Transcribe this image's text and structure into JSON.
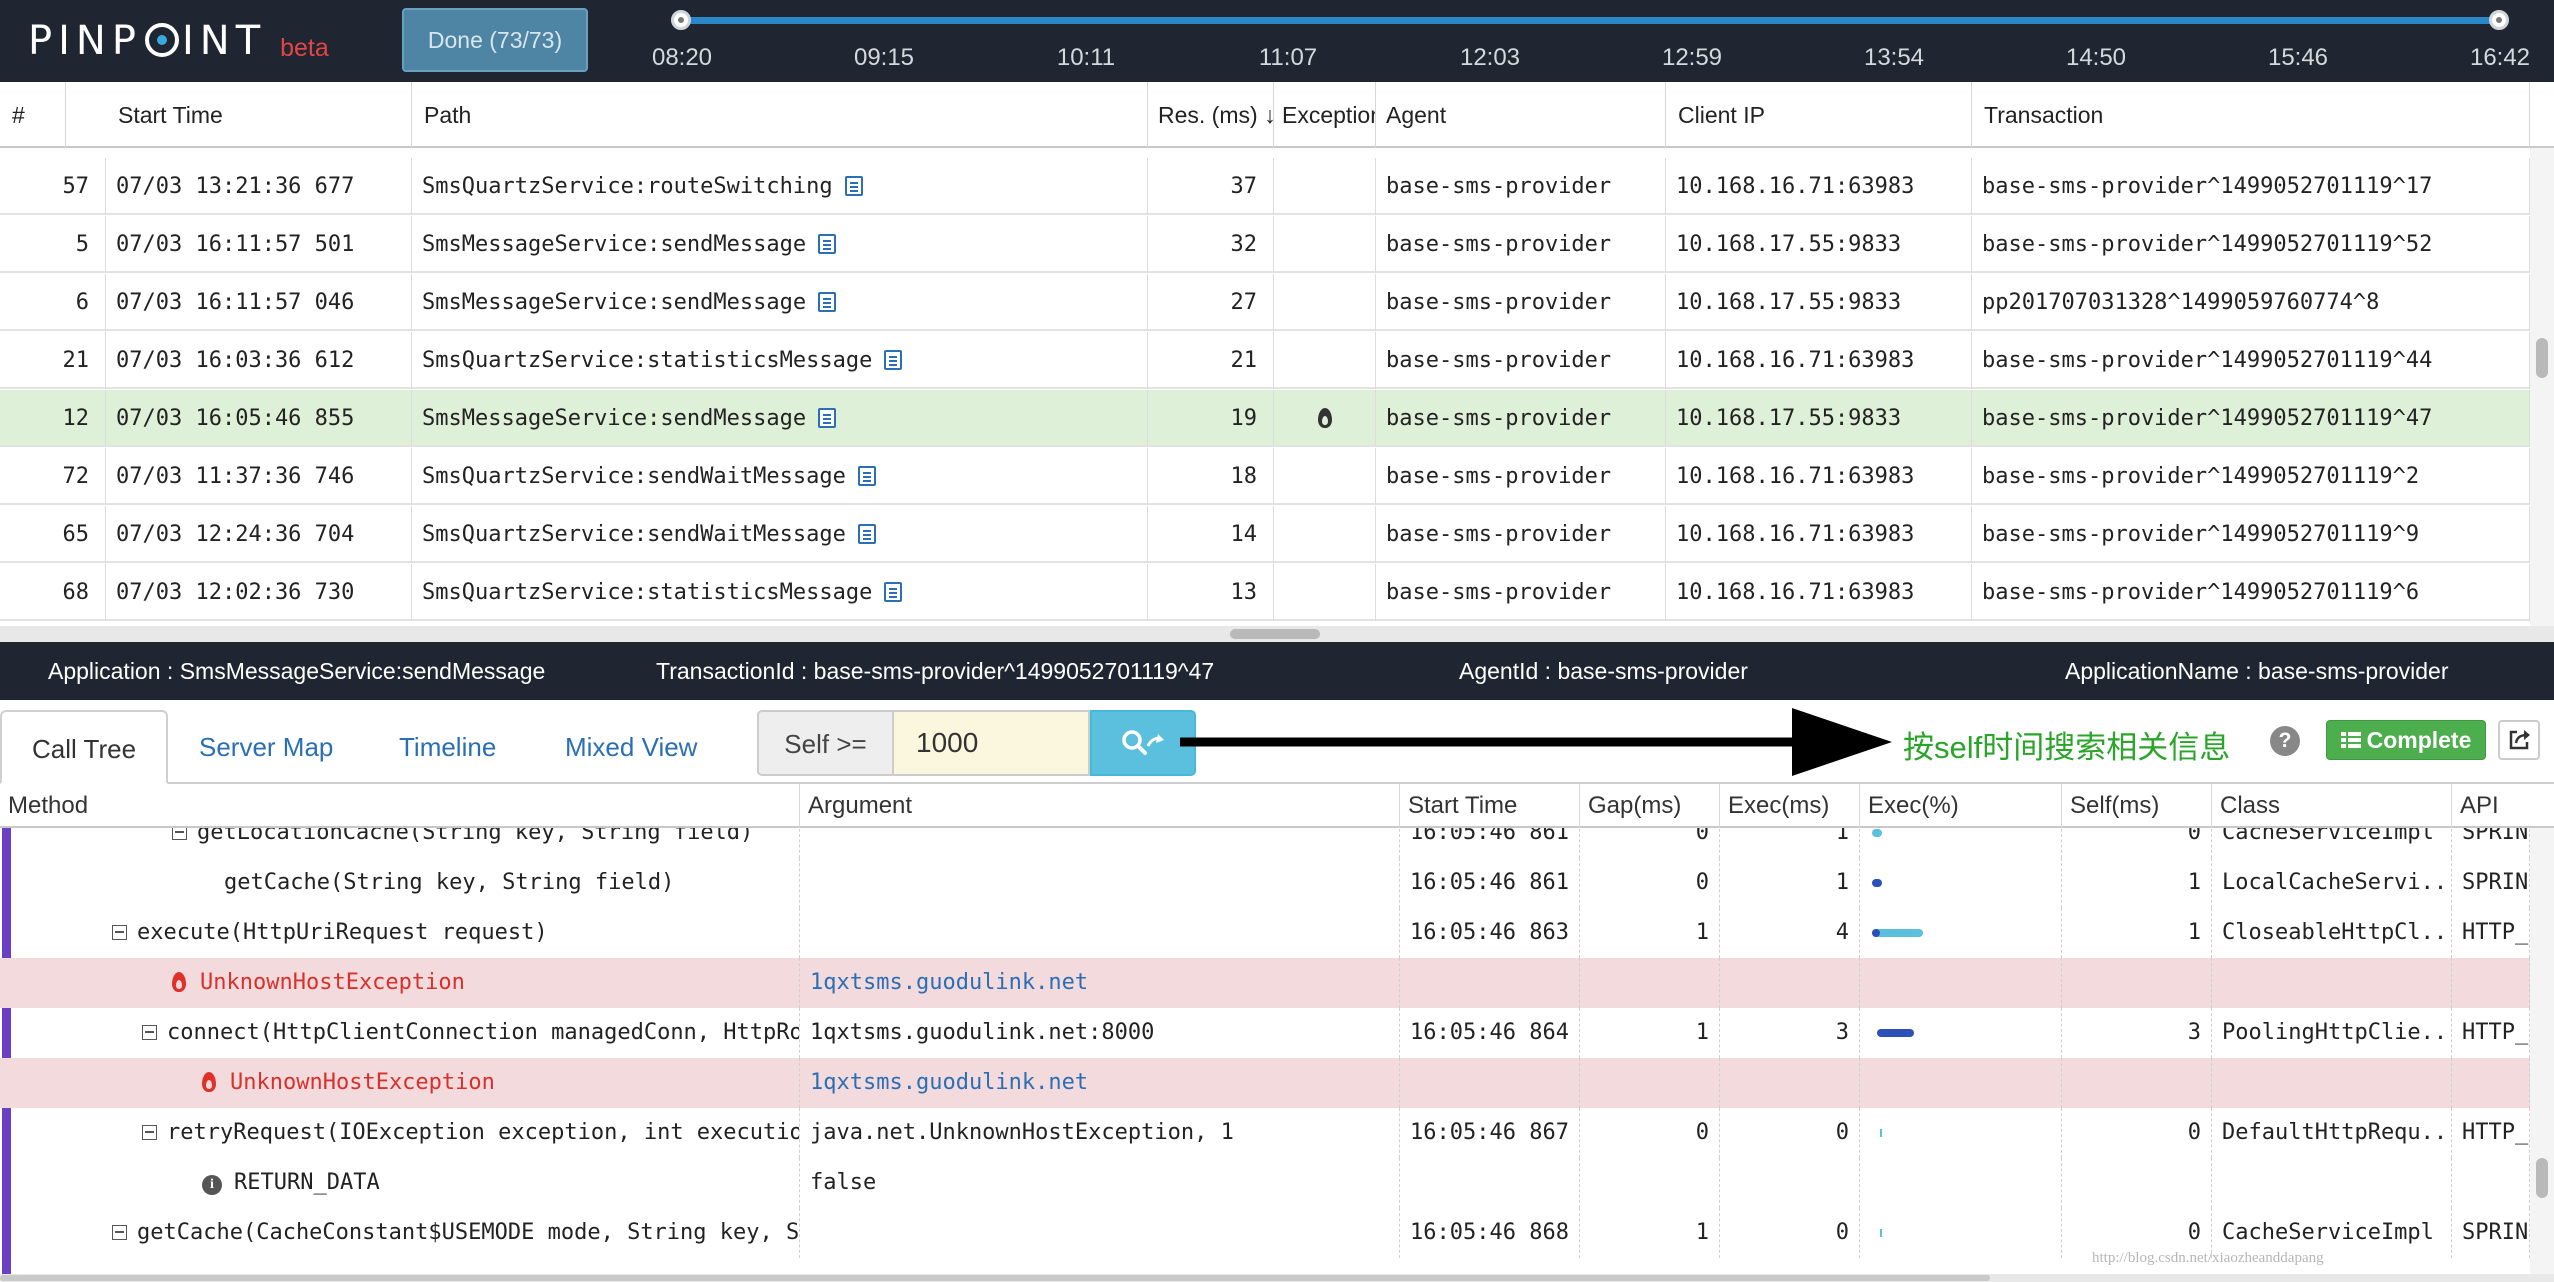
{
  "header": {
    "logo_text": "PINPOINT",
    "beta": "beta",
    "done_button": "Done (73/73)",
    "timeline_ticks": [
      "08:20",
      "09:15",
      "10:11",
      "11:07",
      "12:03",
      "12:59",
      "13:54",
      "14:50",
      "15:46",
      "16:42"
    ]
  },
  "transactions": {
    "columns": [
      "#",
      "Start Time",
      "Path",
      "Res. (ms)",
      "Exception",
      "Agent",
      "Client IP",
      "Transaction"
    ],
    "sort_indicator": "↓",
    "rows": [
      {
        "num": "57",
        "start": "07/03 13:21:36 677",
        "path": "SmsQuartzService:routeSwitching",
        "res": "37",
        "exception": false,
        "agent": "base-sms-provider",
        "ip": "10.168.16.71:63983",
        "tx": "base-sms-provider^1499052701119^17",
        "selected": false
      },
      {
        "num": "5",
        "start": "07/03 16:11:57 501",
        "path": "SmsMessageService:sendMessage",
        "res": "32",
        "exception": false,
        "agent": "base-sms-provider",
        "ip": "10.168.17.55:9833",
        "tx": "base-sms-provider^1499052701119^52",
        "selected": false
      },
      {
        "num": "6",
        "start": "07/03 16:11:57 046",
        "path": "SmsMessageService:sendMessage",
        "res": "27",
        "exception": false,
        "agent": "base-sms-provider",
        "ip": "10.168.17.55:9833",
        "tx": "pp201707031328^1499059760774^8",
        "selected": false
      },
      {
        "num": "21",
        "start": "07/03 16:03:36 612",
        "path": "SmsQuartzService:statisticsMessage",
        "res": "21",
        "exception": false,
        "agent": "base-sms-provider",
        "ip": "10.168.16.71:63983",
        "tx": "base-sms-provider^1499052701119^44",
        "selected": false
      },
      {
        "num": "12",
        "start": "07/03 16:05:46 855",
        "path": "SmsMessageService:sendMessage",
        "res": "19",
        "exception": true,
        "agent": "base-sms-provider",
        "ip": "10.168.17.55:9833",
        "tx": "base-sms-provider^1499052701119^47",
        "selected": true
      },
      {
        "num": "72",
        "start": "07/03 11:37:36 746",
        "path": "SmsQuartzService:sendWaitMessage",
        "res": "18",
        "exception": false,
        "agent": "base-sms-provider",
        "ip": "10.168.16.71:63983",
        "tx": "base-sms-provider^1499052701119^2",
        "selected": false
      },
      {
        "num": "65",
        "start": "07/03 12:24:36 704",
        "path": "SmsQuartzService:sendWaitMessage",
        "res": "14",
        "exception": false,
        "agent": "base-sms-provider",
        "ip": "10.168.16.71:63983",
        "tx": "base-sms-provider^1499052701119^9",
        "selected": false
      },
      {
        "num": "68",
        "start": "07/03 12:02:36 730",
        "path": "SmsQuartzService:statisticsMessage",
        "res": "13",
        "exception": false,
        "agent": "base-sms-provider",
        "ip": "10.168.16.71:63983",
        "tx": "base-sms-provider^1499052701119^6",
        "selected": false
      }
    ]
  },
  "info_bar": {
    "application": "Application : SmsMessageService:sendMessage",
    "transaction_id": "TransactionId : base-sms-provider^1499052701119^47",
    "agent_id": "AgentId : base-sms-provider",
    "application_name": "ApplicationName : base-sms-provider"
  },
  "tabs": {
    "call_tree": "Call Tree",
    "server_map": "Server Map",
    "timeline": "Timeline",
    "mixed_view": "Mixed View",
    "self_label": "Self >=",
    "self_value": "1000",
    "annotation": "按self时间搜索相关信息",
    "help": "?",
    "complete": "Complete"
  },
  "call_tree": {
    "columns": [
      "Method",
      "Argument",
      "Start Time",
      "Gap(ms)",
      "Exec(ms)",
      "Exec(%)",
      "Self(ms)",
      "Class",
      "API"
    ],
    "rows": [
      {
        "kind": "method",
        "toggle": true,
        "method": "getLocationCache(String key, String field)",
        "argument": "",
        "start": "16:05:46 861",
        "gap": "0",
        "exec": "1",
        "bar_start": 0.03,
        "bar_len": 0.0,
        "bar_mark": "dot-light",
        "self": "0",
        "class": "CacheServiceImpl",
        "api": "SPRING"
      },
      {
        "kind": "method",
        "toggle": false,
        "method": "getCache(String key, String field)",
        "argument": "",
        "start": "16:05:46 861",
        "gap": "0",
        "exec": "1",
        "bar_start": 0.03,
        "bar_len": 0.0,
        "bar_mark": "dot-dark",
        "self": "1",
        "class": "LocalCacheServi...",
        "api": "SPRING"
      },
      {
        "kind": "method",
        "toggle": true,
        "method": "execute(HttpUriRequest request)",
        "argument": "",
        "start": "16:05:46 863",
        "gap": "1",
        "exec": "4",
        "bar_start": 0.03,
        "bar_len": 0.3,
        "bar_mark": "bar-light",
        "self": "1",
        "class": "CloseableHttpCl...",
        "api": "HTTP_C"
      },
      {
        "kind": "exception",
        "toggle": false,
        "method": "UnknownHostException",
        "argument": "1qxtsms.guodulink.net",
        "start": "",
        "gap": "",
        "exec": "",
        "bar_start": 0,
        "bar_len": 0,
        "bar_mark": "none",
        "self": "",
        "class": "",
        "api": ""
      },
      {
        "kind": "method",
        "toggle": true,
        "method": "connect(HttpClientConnection managedConn, HttpRoute route, int connectTimeout, HttpContext context)",
        "argument": "1qxtsms.guodulink.net:8000",
        "start": "16:05:46 864",
        "gap": "1",
        "exec": "3",
        "bar_start": 0.06,
        "bar_len": 0.22,
        "bar_mark": "bar-dark",
        "self": "3",
        "class": "PoolingHttpClie...",
        "api": "HTTP_C"
      },
      {
        "kind": "exception",
        "toggle": false,
        "method": "UnknownHostException",
        "argument": "1qxtsms.guodulink.net",
        "start": "",
        "gap": "",
        "exec": "",
        "bar_start": 0,
        "bar_len": 0,
        "bar_mark": "none",
        "self": "",
        "class": "",
        "api": ""
      },
      {
        "kind": "method",
        "toggle": true,
        "method": "retryRequest(IOException exception, int executionCount, HttpContext context)",
        "argument": "java.net.UnknownHostException, 1",
        "start": "16:05:46 867",
        "gap": "0",
        "exec": "0",
        "bar_start": 0.09,
        "bar_len": 0.0,
        "bar_mark": "tick",
        "self": "0",
        "class": "DefaultHttpRequ...",
        "api": "HTTP_C"
      },
      {
        "kind": "info",
        "toggle": false,
        "method": "RETURN_DATA",
        "argument": "false",
        "start": "",
        "gap": "",
        "exec": "",
        "bar_start": 0,
        "bar_len": 0,
        "bar_mark": "none",
        "self": "",
        "class": "",
        "api": ""
      },
      {
        "kind": "method",
        "toggle": true,
        "method": "getCache(CacheConstant$USEMODE mode, String key, String field)",
        "argument": "",
        "start": "16:05:46 868",
        "gap": "1",
        "exec": "0",
        "bar_start": 0.09,
        "bar_len": 0.0,
        "bar_mark": "tick",
        "self": "0",
        "class": "CacheServiceImpl",
        "api": "SPRING"
      }
    ]
  },
  "watermark": "http://blog.csdn.net/xiaozheanddapang",
  "colors": {
    "header_bg": "#1f2631",
    "accent_blue": "#2a6fb5",
    "selected_row": "#dff0d8",
    "exception_row": "#f3dadd",
    "complete_green": "#4cae4c",
    "annotation_green": "#2aa52a"
  },
  "icons": {
    "path_detail": "document-icon",
    "exception": "fire-icon",
    "search": "search-icon",
    "help": "help-icon",
    "external": "external-link-icon"
  }
}
